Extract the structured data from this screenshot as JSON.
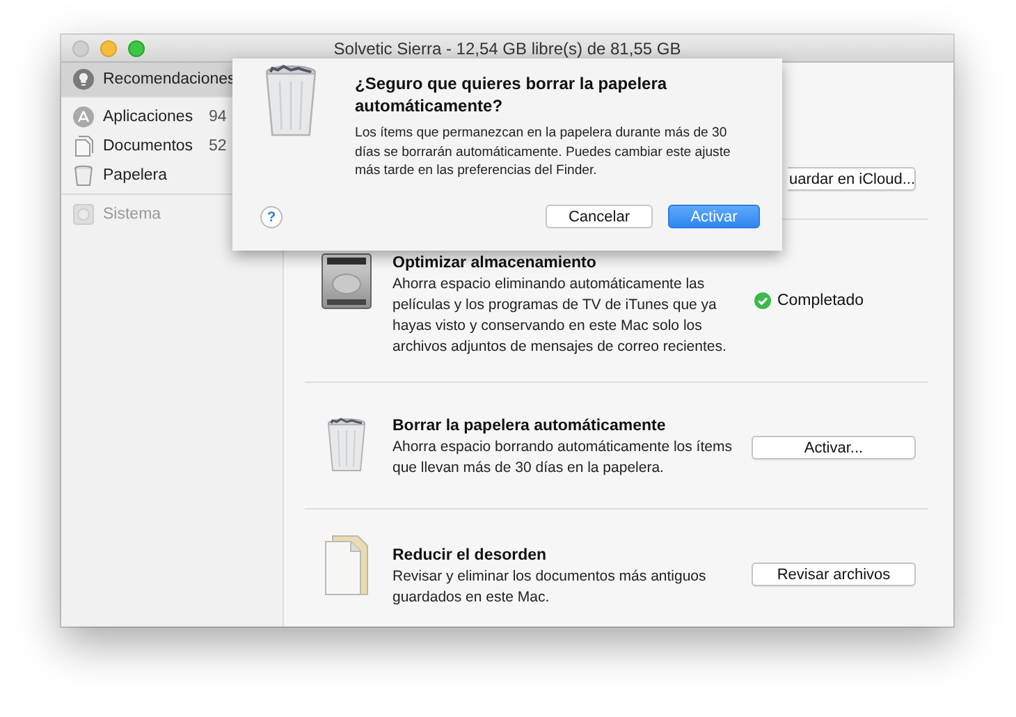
{
  "window": {
    "title": "Solvetic Sierra - 12,54 GB libre(s) de 81,55 GB"
  },
  "sidebar": {
    "groups": [
      [
        {
          "kind": "bulb",
          "label": "Recomendaciones",
          "selected": true,
          "disabled": false
        }
      ],
      [
        {
          "kind": "apps",
          "label": "Aplicaciones",
          "count": "94",
          "selected": false,
          "disabled": false
        },
        {
          "kind": "docs",
          "label": "Documentos",
          "count": "52",
          "selected": false,
          "disabled": false
        },
        {
          "kind": "trash",
          "label": "Papelera",
          "selected": false,
          "disabled": false
        }
      ],
      [
        {
          "kind": "system",
          "label": "Sistema",
          "selected": false,
          "disabled": true
        }
      ]
    ]
  },
  "recommendations": [
    {
      "kind": "hidden",
      "action": {
        "kind": "button",
        "label": "uardar en iCloud..."
      }
    },
    {
      "kind": "disk",
      "title": "Optimizar almacenamiento",
      "description": "Ahorra espacio eliminando automáticamente las películas y los programas de TV de iTunes que ya hayas visto y conservando en este Mac solo los archivos adjuntos de mensajes de correo recientes.",
      "action": {
        "kind": "status",
        "label": "Completado"
      }
    },
    {
      "kind": "trash",
      "title": "Borrar la papelera automáticamente",
      "description": "Ahorra espacio borrando automáticamente los ítems que llevan más de 30 días en la papelera.",
      "action": {
        "kind": "button",
        "label": "Activar..."
      }
    },
    {
      "kind": "docs",
      "title": "Reducir el desorden",
      "description": "Revisar y eliminar los documentos más antiguos guardados en este Mac.",
      "action": {
        "kind": "button",
        "label": "Revisar archivos"
      }
    }
  ],
  "dialog": {
    "title": "¿Seguro que quieres borrar la papelera automáticamente?",
    "message": "Los ítems que permanezcan en la papelera durante más de 30 días se borrarán automáticamente. Puedes cambiar este ajuste más tarde en las preferencias del Finder.",
    "help": "?",
    "buttons": [
      {
        "label": "Cancelar",
        "default": false
      },
      {
        "label": "Activar",
        "default": true
      }
    ]
  }
}
